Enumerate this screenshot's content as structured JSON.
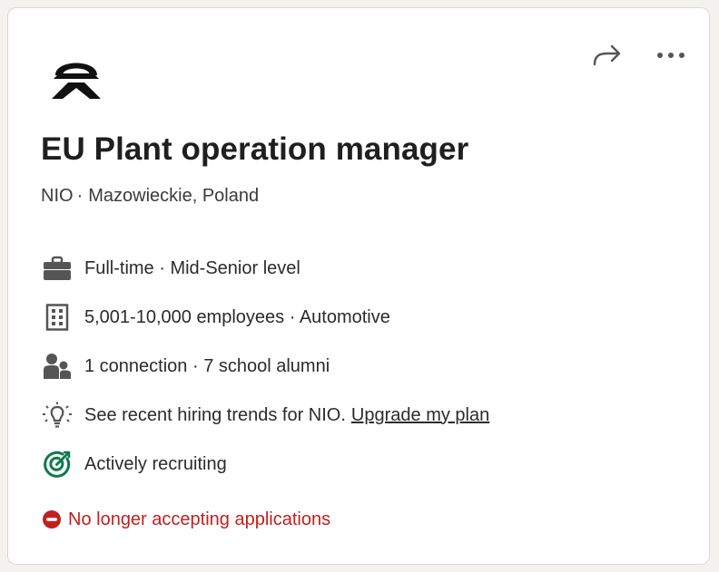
{
  "company": {
    "logo_icon": "nio-logo-icon",
    "name": "NIO",
    "separator": "·",
    "location": "Mazowieckie, Poland"
  },
  "actions": {
    "share_icon": "share-arrow-icon",
    "more_icon": "more-horizontal-icon"
  },
  "job": {
    "title": "EU Plant operation manager"
  },
  "insights": [
    {
      "icon": "briefcase-icon",
      "text": "Full-time · Mid-Senior level"
    },
    {
      "icon": "building-icon",
      "text": "5,001-10,000 employees · Automotive"
    },
    {
      "icon": "people-icon",
      "text": "1 connection · 7 school alumni"
    },
    {
      "icon": "lightbulb-icon",
      "text": "See recent hiring trends for NIO.",
      "link": "Upgrade my plan"
    },
    {
      "icon": "target-icon",
      "text": "Actively recruiting"
    }
  ],
  "status": {
    "icon": "stop-icon",
    "text": "No longer accepting applications",
    "color": "#c21f1f"
  },
  "colors": {
    "recruiting_green": "#0f7a4a",
    "icon_gray": "#555555"
  }
}
